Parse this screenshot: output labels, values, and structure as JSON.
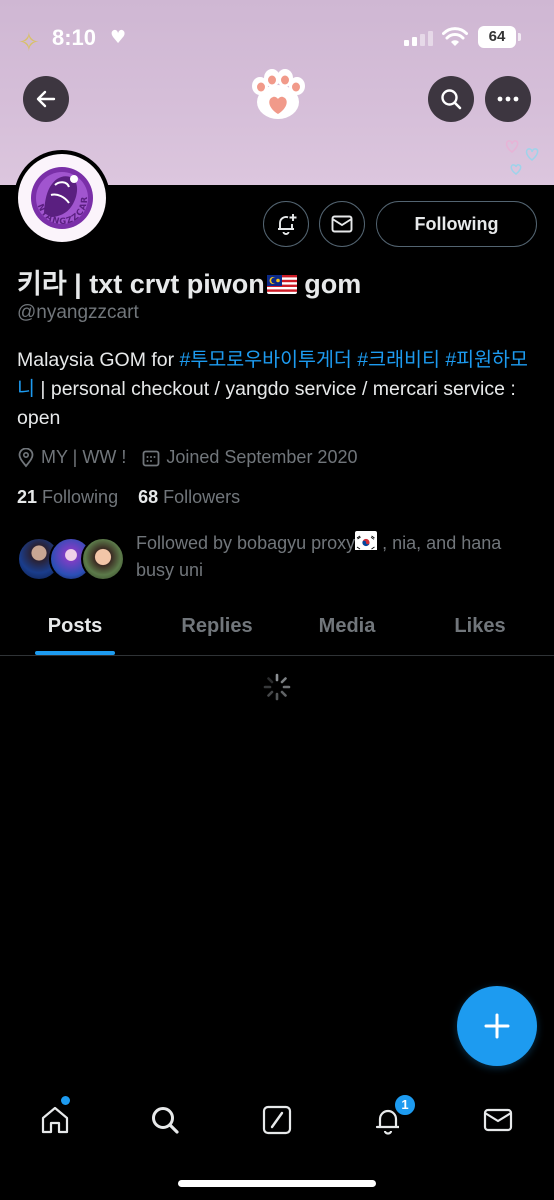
{
  "status_bar": {
    "time": "8:10",
    "battery": "64"
  },
  "profile": {
    "display_name": "키라 | txt crvt piwon",
    "display_name_suffix": "gom",
    "handle": "@nyangzzcart",
    "avatar_text": "NYANGZZCART",
    "bio_prefix": "Malaysia GOM for ",
    "bio_tag1": "#투모로우바이투게더",
    "bio_tag2": "#크래비티",
    "bio_tag3": "#피원하모니",
    "bio_suffix": " | personal checkout / yangdo service / mercari service : open",
    "location": "MY | WW !",
    "joined": "Joined September 2020",
    "following_count": "21",
    "following_label": "Following",
    "followers_count": "68",
    "followers_label": "Followers",
    "followed_by_prefix": "Followed by bobagyu proxy",
    "followed_by_suffix": " , nia, and hana busy uni"
  },
  "actions": {
    "following_button": "Following"
  },
  "tabs": [
    {
      "label": "Posts",
      "active": true
    },
    {
      "label": "Replies",
      "active": false
    },
    {
      "label": "Media",
      "active": false
    },
    {
      "label": "Likes",
      "active": false
    }
  ],
  "bottom_nav": {
    "notifications_badge": "1"
  },
  "colors": {
    "accent": "#1d9bf0",
    "banner": "#d6bfd9",
    "background": "#000000",
    "muted": "#71767b"
  }
}
